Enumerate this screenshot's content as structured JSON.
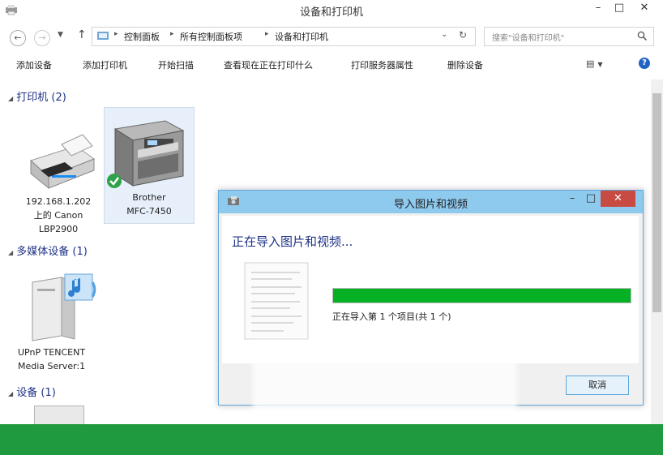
{
  "window": {
    "title": "设备和打印机",
    "minimize": "–",
    "maximize": "□",
    "close": "✕"
  },
  "address": {
    "crumbs": [
      "控制面板",
      "所有控制面板项",
      "设备和打印机"
    ],
    "search_placeholder": "搜索\"设备和打印机\""
  },
  "commands": [
    "添加设备",
    "添加打印机",
    "开始扫描",
    "查看现在正在打印什么",
    "打印服务器属性",
    "删除设备"
  ],
  "groups": {
    "printers": {
      "header": "打印机 (2)",
      "devices": [
        {
          "line1": "192.168.1.202",
          "line2": "上的 Canon",
          "line3": "LBP2900"
        },
        {
          "line1": "Brother",
          "line2": "MFC-7450"
        }
      ]
    },
    "multimedia": {
      "header": "多媒体设备 (1)",
      "devices": [
        {
          "line1": "UPnP TENCENT",
          "line2": "Media Server:1"
        }
      ]
    },
    "devices": {
      "header": "设备 (1)"
    }
  },
  "dialog": {
    "title": "导入图片和视频",
    "heading": "正在导入图片和视频...",
    "status": "正在导入第 1 个项目(共 1 个)",
    "progress": 1.0,
    "cancel": "取消",
    "minimize": "–",
    "maximize": "□",
    "close": "✕"
  },
  "colors": {
    "group_header": "#1e3287",
    "progress_fill": "#06b025",
    "dialog_title": "#8ec9ee",
    "footer_bar": "#1f9a3e"
  }
}
